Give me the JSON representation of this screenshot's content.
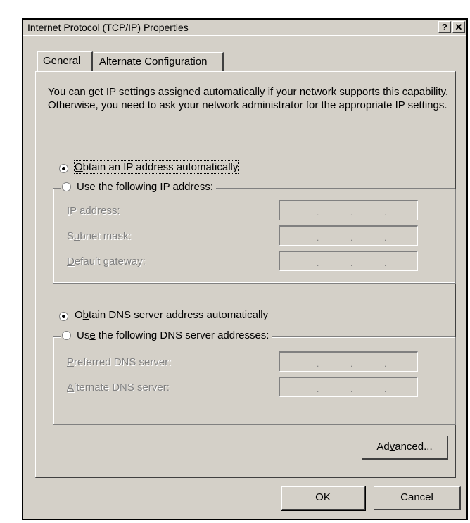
{
  "window": {
    "title": "Internet Protocol (TCP/IP) Properties",
    "help_glyph": "?",
    "close_glyph": "✕"
  },
  "tabs": [
    {
      "label": "General",
      "active": true
    },
    {
      "label": "Alternate Configuration",
      "active": false
    }
  ],
  "intro_text": "You can get IP settings assigned automatically if your network supports this capability. Otherwise, you need to ask your network administrator for the appropriate IP settings.",
  "ip": {
    "auto_label": {
      "pre": "",
      "key": "O",
      "post": "btain an IP address automatically"
    },
    "manual_label": {
      "pre": "U",
      "key": "s",
      "post": "e the following IP address:"
    },
    "auto_selected": true,
    "fields": [
      {
        "pre": "",
        "key": "I",
        "post": "P address:"
      },
      {
        "pre": "S",
        "key": "u",
        "post": "bnet mask:"
      },
      {
        "pre": "",
        "key": "D",
        "post": "efault gateway:"
      }
    ]
  },
  "dns": {
    "auto_label": {
      "pre": "O",
      "key": "b",
      "post": "tain DNS server address automatically"
    },
    "manual_label": {
      "pre": "Us",
      "key": "e",
      "post": " the following DNS server addresses:"
    },
    "auto_selected": true,
    "fields": [
      {
        "pre": "",
        "key": "P",
        "post": "referred DNS server:"
      },
      {
        "pre": "",
        "key": "A",
        "post": "lternate DNS server:"
      }
    ]
  },
  "ip_dots": ".",
  "buttons": {
    "advanced": {
      "pre": "Ad",
      "key": "v",
      "post": "anced..."
    },
    "ok": "OK",
    "cancel": "Cancel"
  }
}
